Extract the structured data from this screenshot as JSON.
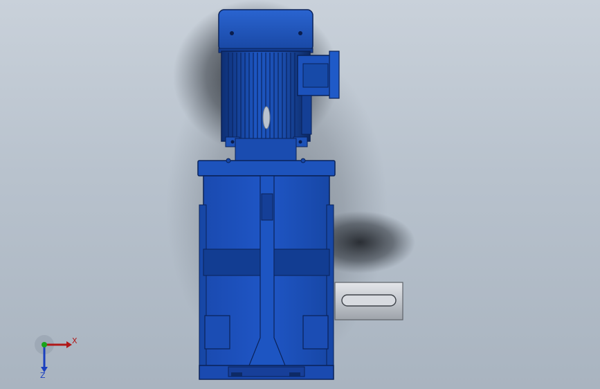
{
  "viewport": {
    "background_top": "#c9d1da",
    "background_bottom": "#a9b4c0",
    "model_color": "#1b4fb0",
    "model_shadow": "#123a85",
    "shaft_color": "#cfd3d8"
  },
  "model": {
    "icon": "gearmotor-3d-model"
  },
  "triad": {
    "x_label": "X",
    "z_label": "Z",
    "x_color": "#b01818",
    "y_color": "#1aa31a",
    "z_color": "#1a3fbf"
  }
}
